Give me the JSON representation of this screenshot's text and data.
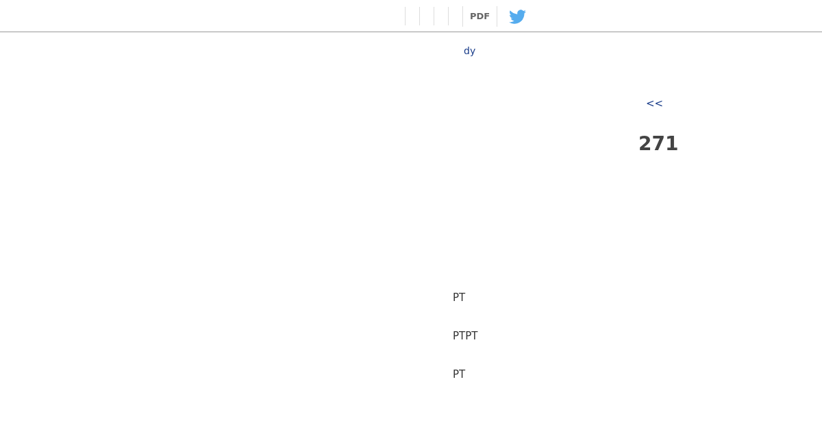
{
  "toolbar": {
    "pdf_link": "PDF"
  },
  "link": "dy",
  "back_link": "<<",
  "page_number": "271",
  "lines": [
    "PT",
    "PTPT",
    "PT"
  ]
}
